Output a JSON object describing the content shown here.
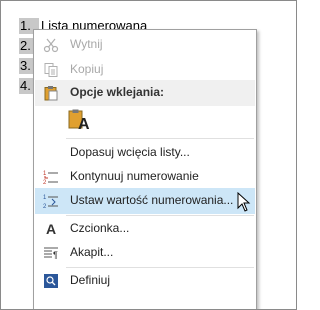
{
  "document": {
    "items": [
      {
        "num": "1.",
        "text": "Lista numerowana"
      },
      {
        "num": "2.",
        "text": ""
      },
      {
        "num": "3.",
        "text": ""
      },
      {
        "num": "4.",
        "text": ""
      }
    ]
  },
  "menu": {
    "cut": "Wytnij",
    "copy": "Kopiuj",
    "paste_options": "Opcje wklejania:",
    "paste_letter": "A",
    "adjust_indents": "Dopasuj wcięcia listy...",
    "continue_numbering": "Kontynuuj numerowanie",
    "set_numbering_value": "Ustaw wartość numerowania...",
    "font": "Czcionka...",
    "paragraph": "Akapit...",
    "define": "Definiuj"
  },
  "colors": {
    "hover": "#cde6f7",
    "accent": "#2b579a",
    "red_icon": "#c0392b"
  }
}
